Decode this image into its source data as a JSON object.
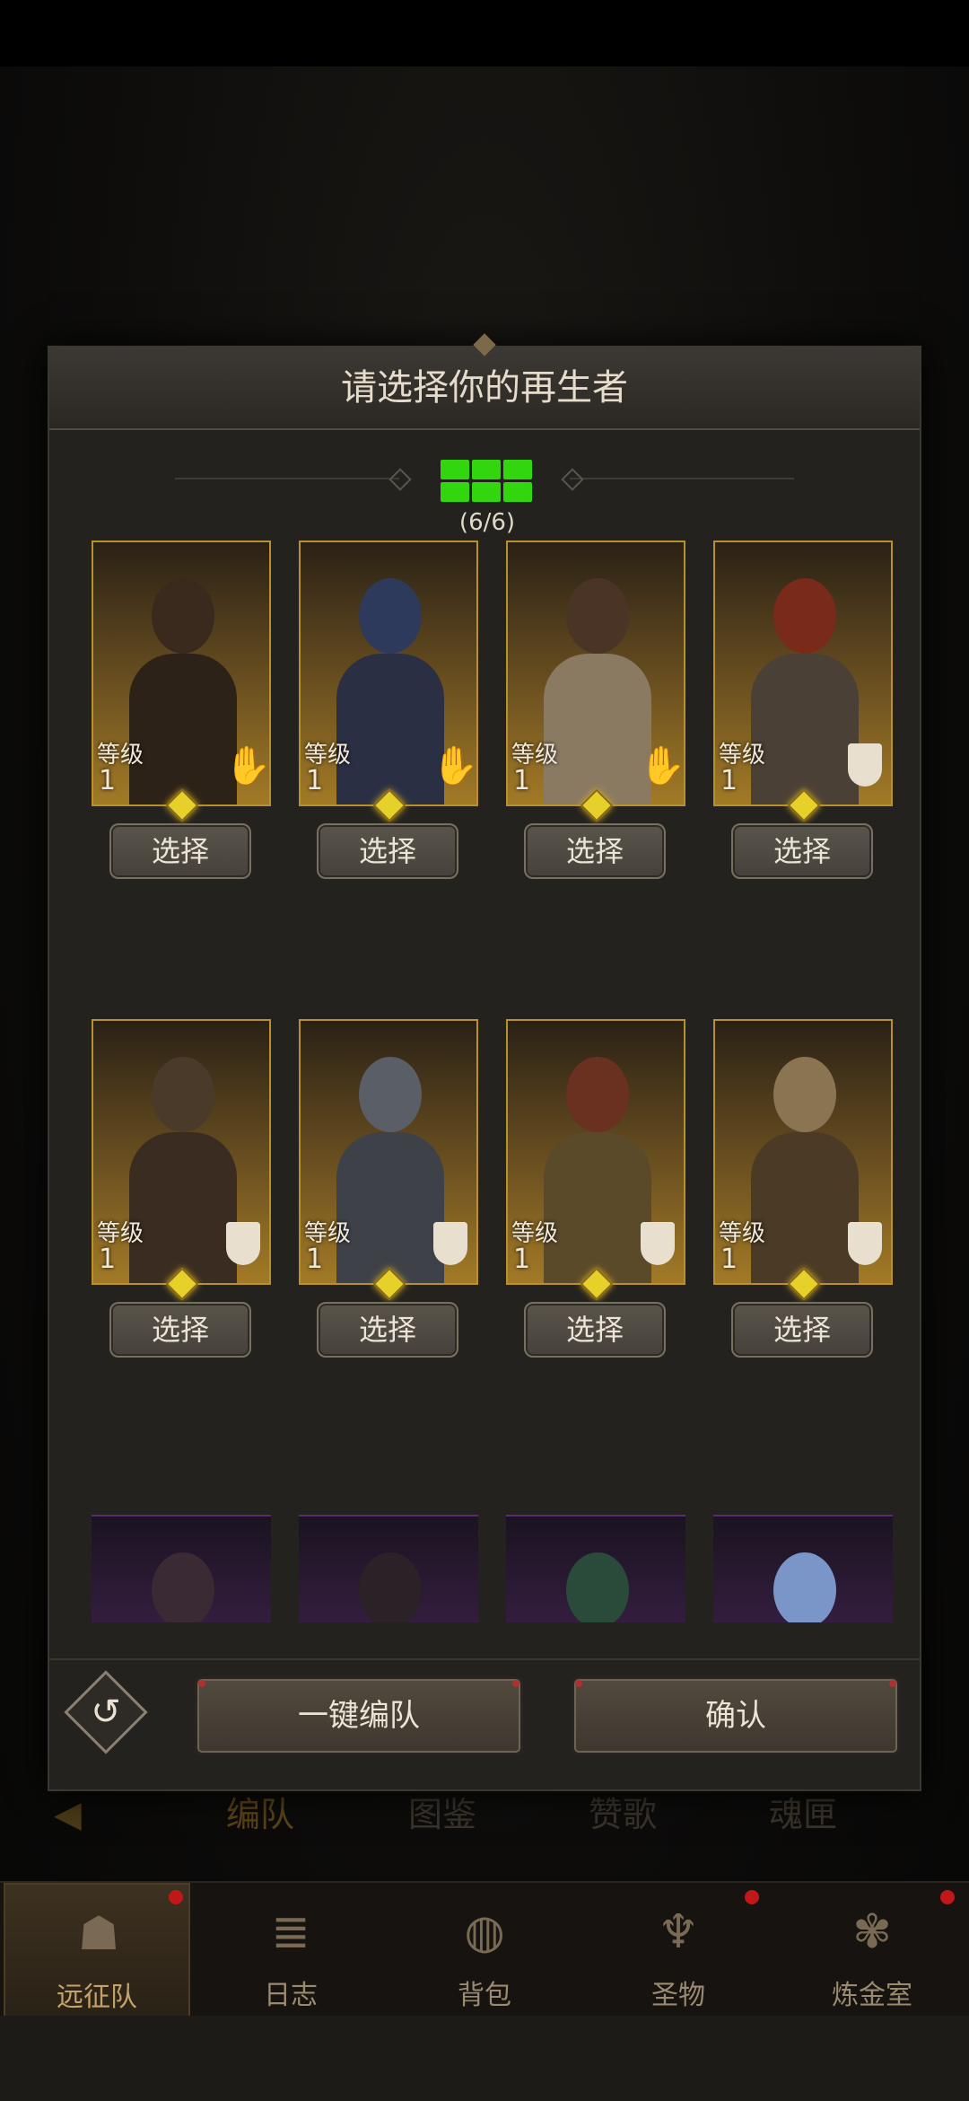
{
  "modal": {
    "title": "请选择你的再生者",
    "team_count": "(6/6)",
    "level_label": "等级",
    "select_label": "选择",
    "auto_team_label": "一键编队",
    "confirm_label": "确认"
  },
  "heroes": [
    {
      "level": "1",
      "class_icon": "hand-icon"
    },
    {
      "level": "1",
      "class_icon": "hand-icon"
    },
    {
      "level": "1",
      "class_icon": "hand-icon"
    },
    {
      "level": "1",
      "class_icon": "shield-icon"
    },
    {
      "level": "1",
      "class_icon": "shield-icon"
    },
    {
      "level": "1",
      "class_icon": "shield-icon"
    },
    {
      "level": "1",
      "class_icon": "shield-icon"
    },
    {
      "level": "1",
      "class_icon": "shield-icon"
    }
  ],
  "background_tabs": [
    "编队",
    "图鉴",
    "赞歌",
    "魂匣"
  ],
  "bottom_nav": [
    {
      "label": "远征队",
      "icon": "horned-helmet-icon",
      "active": true,
      "badge": true
    },
    {
      "label": "日志",
      "icon": "scroll-icon",
      "active": false,
      "badge": false
    },
    {
      "label": "背包",
      "icon": "bag-icon",
      "active": false,
      "badge": false
    },
    {
      "label": "圣物",
      "icon": "chalice-icon",
      "active": false,
      "badge": true
    },
    {
      "label": "炼金室",
      "icon": "alchemy-icon",
      "active": false,
      "badge": true
    }
  ],
  "colors": {
    "accent_green": "#32d60e",
    "gold_border": "#b8902c",
    "modal_bg": "#24221f"
  }
}
